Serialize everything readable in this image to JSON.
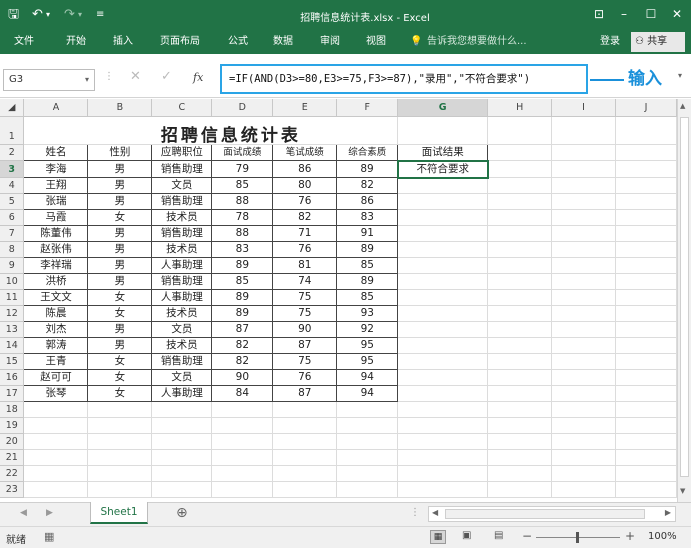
{
  "window": {
    "title": "招聘信息统计表.xlsx - Excel"
  },
  "ribbon": {
    "tabs": [
      "文件",
      "开始",
      "插入",
      "页面布局",
      "公式",
      "数据",
      "审阅",
      "视图"
    ],
    "tell_me": "告诉我您想要做什么...",
    "login": "登录",
    "share": "共享"
  },
  "formula_bar": {
    "name_box": "G3",
    "formula": "=IF(AND(D3>=80,E3>=75,F3>=87),\"录用\",\"不符合要求\")",
    "callout": "输入"
  },
  "sheet": {
    "column_headers": [
      "A",
      "B",
      "C",
      "D",
      "E",
      "F",
      "G",
      "H",
      "I",
      "J"
    ],
    "row_numbers": [
      "1",
      "2",
      "3",
      "4",
      "5",
      "6",
      "7",
      "8",
      "9",
      "10",
      "11",
      "12",
      "13",
      "14",
      "15",
      "16",
      "17",
      "18",
      "19",
      "20",
      "21",
      "22",
      "23"
    ],
    "title": "招聘信息统计表",
    "headers": [
      "姓名",
      "性别",
      "应聘职位",
      "面试成绩",
      "笔试成绩",
      "综合素质",
      "面试结果"
    ],
    "rows": [
      [
        "李海",
        "男",
        "销售助理",
        "79",
        "86",
        "89",
        "不符合要求"
      ],
      [
        "王翔",
        "男",
        "文员",
        "85",
        "80",
        "82",
        ""
      ],
      [
        "张瑞",
        "男",
        "销售助理",
        "88",
        "76",
        "86",
        ""
      ],
      [
        "马霞",
        "女",
        "技术员",
        "78",
        "82",
        "83",
        ""
      ],
      [
        "陈董伟",
        "男",
        "销售助理",
        "88",
        "71",
        "91",
        ""
      ],
      [
        "赵张伟",
        "男",
        "技术员",
        "83",
        "76",
        "89",
        ""
      ],
      [
        "李祥瑞",
        "男",
        "人事助理",
        "89",
        "81",
        "85",
        ""
      ],
      [
        "洪桥",
        "男",
        "销售助理",
        "85",
        "74",
        "89",
        ""
      ],
      [
        "王文文",
        "女",
        "人事助理",
        "89",
        "75",
        "85",
        ""
      ],
      [
        "陈晨",
        "女",
        "技术员",
        "89",
        "75",
        "93",
        ""
      ],
      [
        "刘杰",
        "男",
        "文员",
        "87",
        "90",
        "92",
        ""
      ],
      [
        "郭涛",
        "男",
        "技术员",
        "82",
        "87",
        "95",
        ""
      ],
      [
        "王青",
        "女",
        "销售助理",
        "82",
        "75",
        "95",
        ""
      ],
      [
        "赵可可",
        "女",
        "文员",
        "90",
        "76",
        "94",
        ""
      ],
      [
        "张琴",
        "女",
        "人事助理",
        "84",
        "87",
        "94",
        ""
      ]
    ]
  },
  "sheet_tabs": {
    "active": "Sheet1"
  },
  "status": {
    "mode": "就绪",
    "zoom": "100%"
  }
}
